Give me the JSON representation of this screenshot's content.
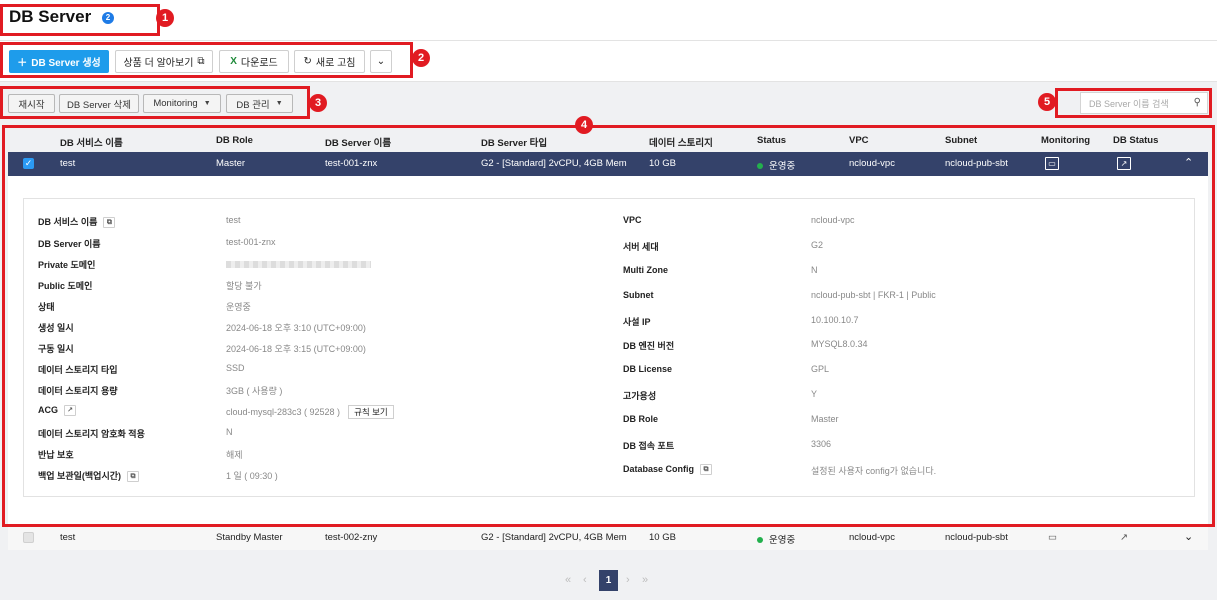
{
  "header": {
    "title": "DB Server",
    "help_badge": "2"
  },
  "toolbar": {
    "create_label": "DB Server 생성",
    "learn_more_label": "상품 더 알아보기",
    "download_label": "다운로드",
    "refresh_label": "새로 고침"
  },
  "actions": {
    "restart_label": "재시작",
    "delete_label": "DB Server 삭제",
    "monitoring_label": "Monitoring",
    "db_manage_label": "DB 관리"
  },
  "search": {
    "placeholder": "DB Server 이름 검색"
  },
  "table": {
    "columns": [
      "DB 서비스 이름",
      "DB Role",
      "DB Server 이름",
      "DB Server 타입",
      "데이터 스토리지",
      "Status",
      "VPC",
      "Subnet",
      "Monitoring",
      "DB Status"
    ],
    "rows": [
      {
        "service": "test",
        "role": "Master",
        "server": "test-001-znx",
        "type": "G2 - [Standard] 2vCPU, 4GB Mem",
        "storage": "10 GB",
        "status": "운영중",
        "vpc": "ncloud-vpc",
        "subnet": "ncloud-pub-sbt",
        "checked": true
      },
      {
        "service": "test",
        "role": "Standby Master",
        "server": "test-002-zny",
        "type": "G2 - [Standard] 2vCPU, 4GB Mem",
        "storage": "10 GB",
        "status": "운영중",
        "vpc": "ncloud-vpc",
        "subnet": "ncloud-pub-sbt",
        "checked": false
      }
    ]
  },
  "detail": {
    "left": [
      {
        "label": "DB 서비스 이름",
        "value": "test"
      },
      {
        "label": "DB Server 이름",
        "value": "test-001-znx"
      },
      {
        "label": "Private 도메인",
        "value": ""
      },
      {
        "label": "Public 도메인",
        "value": "할당 불가"
      },
      {
        "label": "상태",
        "value": "운영중"
      },
      {
        "label": "생성 일시",
        "value": "2024-06-18 오후 3:10 (UTC+09:00)"
      },
      {
        "label": "구동 일시",
        "value": "2024-06-18 오후 3:15 (UTC+09:00)"
      },
      {
        "label": "데이터 스토리지 타입",
        "value": "SSD"
      },
      {
        "label": "데이터 스토리지 용량",
        "value": "3GB ( 사용량 )"
      },
      {
        "label": "ACG",
        "value": "cloud-mysql-283c3 ( 92528 )"
      },
      {
        "label": "데이터 스토리지 암호화 적용",
        "value": "N"
      },
      {
        "label": "반납 보호",
        "value": "해제"
      },
      {
        "label": "백업 보관일(백업시간)",
        "value": "1 일 ( 09:30 )"
      }
    ],
    "right": [
      {
        "label": "VPC",
        "value": "ncloud-vpc"
      },
      {
        "label": "서버 세대",
        "value": "G2"
      },
      {
        "label": "Multi Zone",
        "value": "N"
      },
      {
        "label": "Subnet",
        "value": "ncloud-pub-sbt | FKR-1 | Public"
      },
      {
        "label": "사설 IP",
        "value": "10.100.10.7"
      },
      {
        "label": "DB 엔진 버전",
        "value": "MYSQL8.0.34"
      },
      {
        "label": "DB License",
        "value": "GPL"
      },
      {
        "label": "고가용성",
        "value": "Y"
      },
      {
        "label": "DB Role",
        "value": "Master"
      },
      {
        "label": "DB 접속 포트",
        "value": "3306"
      },
      {
        "label": "Database Config",
        "value": "설정된 사용자 config가 없습니다."
      }
    ],
    "acg_rule_button": "규칙 보기"
  },
  "pagination": {
    "current": "1"
  },
  "annotations": [
    "1",
    "2",
    "3",
    "4",
    "5"
  ],
  "colors": {
    "primary": "#1e9ceb",
    "selected_row": "#34426a",
    "annotation": "#e11b22",
    "status_ok": "#23b04d"
  }
}
